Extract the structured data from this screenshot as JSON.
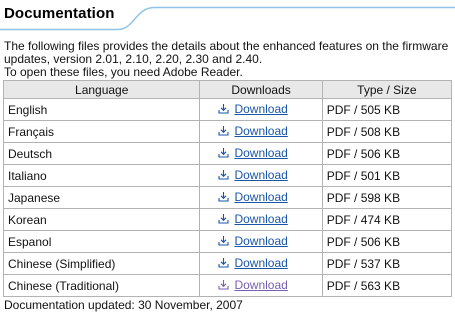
{
  "header": {
    "title": "Documentation"
  },
  "intro": {
    "line1": "The following files provides the details about the enhanced features on the firmware updates, version 2.01, 2.10, 2.20, 2.30 and 2.40.",
    "line2": "To open these files, you need Adobe Reader."
  },
  "table": {
    "columns": [
      "Language",
      "Downloads",
      "Type / Size"
    ],
    "rows": [
      {
        "language": "English",
        "download": "Download",
        "type_size": "PDF / 505 KB",
        "visited": false
      },
      {
        "language": "Français",
        "download": "Download",
        "type_size": "PDF / 508 KB",
        "visited": false
      },
      {
        "language": "Deutsch",
        "download": "Download",
        "type_size": "PDF / 506 KB",
        "visited": false
      },
      {
        "language": "Italiano",
        "download": "Download",
        "type_size": "PDF / 501 KB",
        "visited": false
      },
      {
        "language": "Japanese",
        "download": "Download",
        "type_size": "PDF / 598 KB",
        "visited": false
      },
      {
        "language": "Korean",
        "download": "Download",
        "type_size": "PDF / 474 KB",
        "visited": false
      },
      {
        "language": "Espanol",
        "download": "Download",
        "type_size": "PDF / 506 KB",
        "visited": false
      },
      {
        "language": "Chinese (Simplified)",
        "download": "Download",
        "type_size": "PDF / 537 KB",
        "visited": false
      },
      {
        "language": "Chinese (Traditional)",
        "download": "Download",
        "type_size": "PDF / 563 KB",
        "visited": true
      }
    ],
    "download_icon": "download-arrow-icon"
  },
  "footer": {
    "updated": "Documentation updated: 30 November, 2007"
  },
  "colors": {
    "link": "#1a56a8",
    "link_visited": "#7a5fb0",
    "header_rule": "#8fc3e8",
    "table_header_bg": "#e8e8e8",
    "border": "#b3b3b3"
  }
}
